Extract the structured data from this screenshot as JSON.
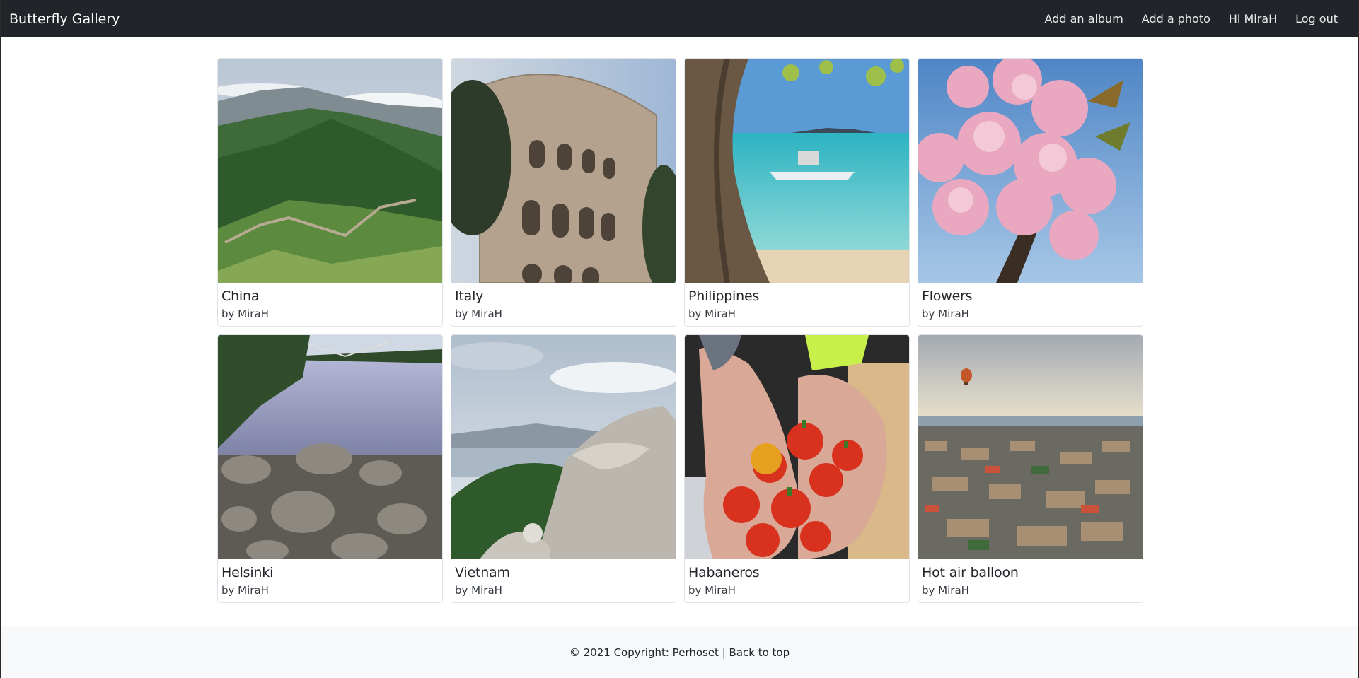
{
  "navbar": {
    "brand": "Butterfly Gallery",
    "links": [
      "Add an album",
      "Add a photo",
      "Hi MiraH",
      "Log out"
    ]
  },
  "albums": [
    {
      "title": "China",
      "author": "by MiraH"
    },
    {
      "title": "Italy",
      "author": "by MiraH"
    },
    {
      "title": "Philippines",
      "author": "by MiraH"
    },
    {
      "title": "Flowers",
      "author": "by MiraH"
    },
    {
      "title": "Helsinki",
      "author": "by MiraH"
    },
    {
      "title": "Vietnam",
      "author": "by MiraH"
    },
    {
      "title": "Habaneros",
      "author": "by MiraH"
    },
    {
      "title": "Hot air balloon",
      "author": "by MiraH"
    }
  ],
  "footer": {
    "copyright": "© 2021 Copyright: Perhoset | ",
    "back_to_top": "Back to top"
  },
  "colors": {
    "navbar_bg": "#212529",
    "footer_bg": "#f8f9fa",
    "card_border": "#dfe2e6"
  }
}
